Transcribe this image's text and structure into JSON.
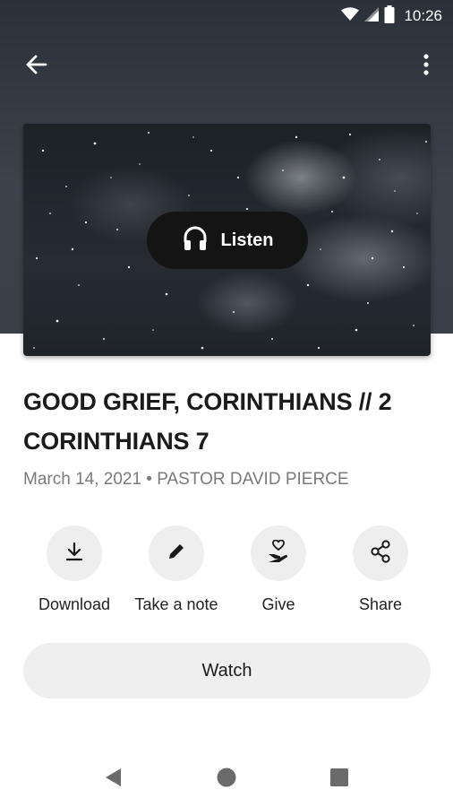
{
  "status_bar": {
    "time": "10:26",
    "icons": [
      "wifi-icon",
      "signal-icon",
      "battery-icon"
    ]
  },
  "app_bar": {
    "back_icon": "arrow-left-icon",
    "more_icon": "more-vertical-icon"
  },
  "hero": {
    "listen_label": "Listen",
    "listen_icon": "headphones-icon"
  },
  "sermon": {
    "title": "GOOD GRIEF, CORINTHIANS // 2 CORINTHIANS 7",
    "meta": "March 14, 2021 • PASTOR DAVID PIERCE"
  },
  "actions": [
    {
      "label": "Download",
      "icon": "download-icon"
    },
    {
      "label": "Take a note",
      "icon": "pencil-icon"
    },
    {
      "label": "Give",
      "icon": "give-heart-hand-icon"
    },
    {
      "label": "Share",
      "icon": "share-icon"
    }
  ],
  "watch": {
    "label": "Watch"
  },
  "nav_bar": {
    "icons": [
      "back-triangle-icon",
      "home-circle-icon",
      "recents-square-icon"
    ]
  },
  "colors": {
    "header_bg": "#2b3139",
    "listen_bg": "#141414",
    "button_bg": "#eeeeee",
    "meta_text": "#7a7a7a"
  }
}
